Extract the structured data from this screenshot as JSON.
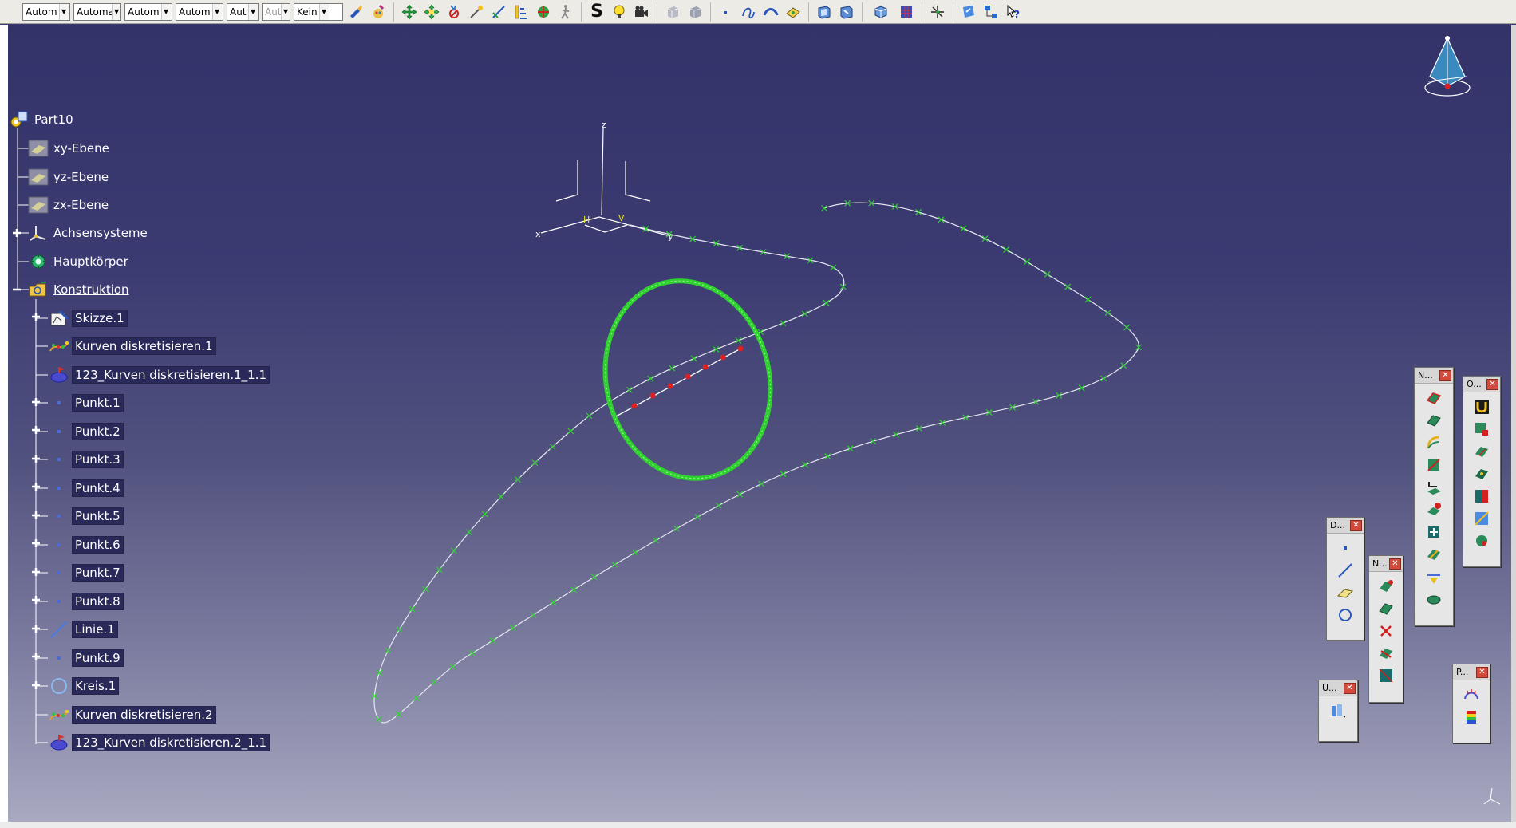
{
  "toolbar": {
    "combos": [
      "Autom",
      "Automa",
      "Autom",
      "Autom",
      "Aut",
      "Aut",
      "Kein"
    ],
    "bold_s": "S"
  },
  "tree": {
    "root": "Part10",
    "items": [
      {
        "label": "xy-Ebene",
        "icon": "plane-icon"
      },
      {
        "label": "yz-Ebene",
        "icon": "plane-icon"
      },
      {
        "label": "zx-Ebene",
        "icon": "plane-icon"
      },
      {
        "label": "Achsensysteme",
        "icon": "axis-system-icon"
      },
      {
        "label": "Hauptkörper",
        "icon": "body-icon"
      },
      {
        "label": "Konstruktion",
        "icon": "geometrical-set-icon"
      }
    ],
    "children": [
      {
        "label": "Skizze.1",
        "icon": "sketch-icon"
      },
      {
        "label": "Kurven diskretisieren.1",
        "icon": "discretize-icon"
      },
      {
        "label": "123_Kurven diskretisieren.1_1.1",
        "icon": "discretize-result-icon"
      },
      {
        "label": "Punkt.1",
        "icon": "point-icon"
      },
      {
        "label": "Punkt.2",
        "icon": "point-icon"
      },
      {
        "label": "Punkt.3",
        "icon": "point-icon"
      },
      {
        "label": "Punkt.4",
        "icon": "point-icon"
      },
      {
        "label": "Punkt.5",
        "icon": "point-icon"
      },
      {
        "label": "Punkt.6",
        "icon": "point-icon"
      },
      {
        "label": "Punkt.7",
        "icon": "point-icon"
      },
      {
        "label": "Punkt.8",
        "icon": "point-icon"
      },
      {
        "label": "Linie.1",
        "icon": "line-icon"
      },
      {
        "label": "Punkt.9",
        "icon": "point-icon"
      },
      {
        "label": "Kreis.1",
        "icon": "circle-icon"
      },
      {
        "label": "Kurven diskretisieren.2",
        "icon": "discretize-icon"
      },
      {
        "label": "123_Kurven diskretisieren.2_1.1",
        "icon": "discretize-result-icon"
      }
    ]
  },
  "axis": {
    "x": "x",
    "y": "y",
    "z": "z",
    "h": "H",
    "v": "V"
  },
  "floating_toolbars": {
    "n1": "N...",
    "o": "O...",
    "d": "D...",
    "n2": "N...",
    "u": "U...",
    "p": "P..."
  },
  "colors": {
    "curve_marker": "#2fd12f",
    "point_red": "#e02020",
    "viewport_top": "#33336a",
    "viewport_bottom": "#a9a9c1"
  }
}
